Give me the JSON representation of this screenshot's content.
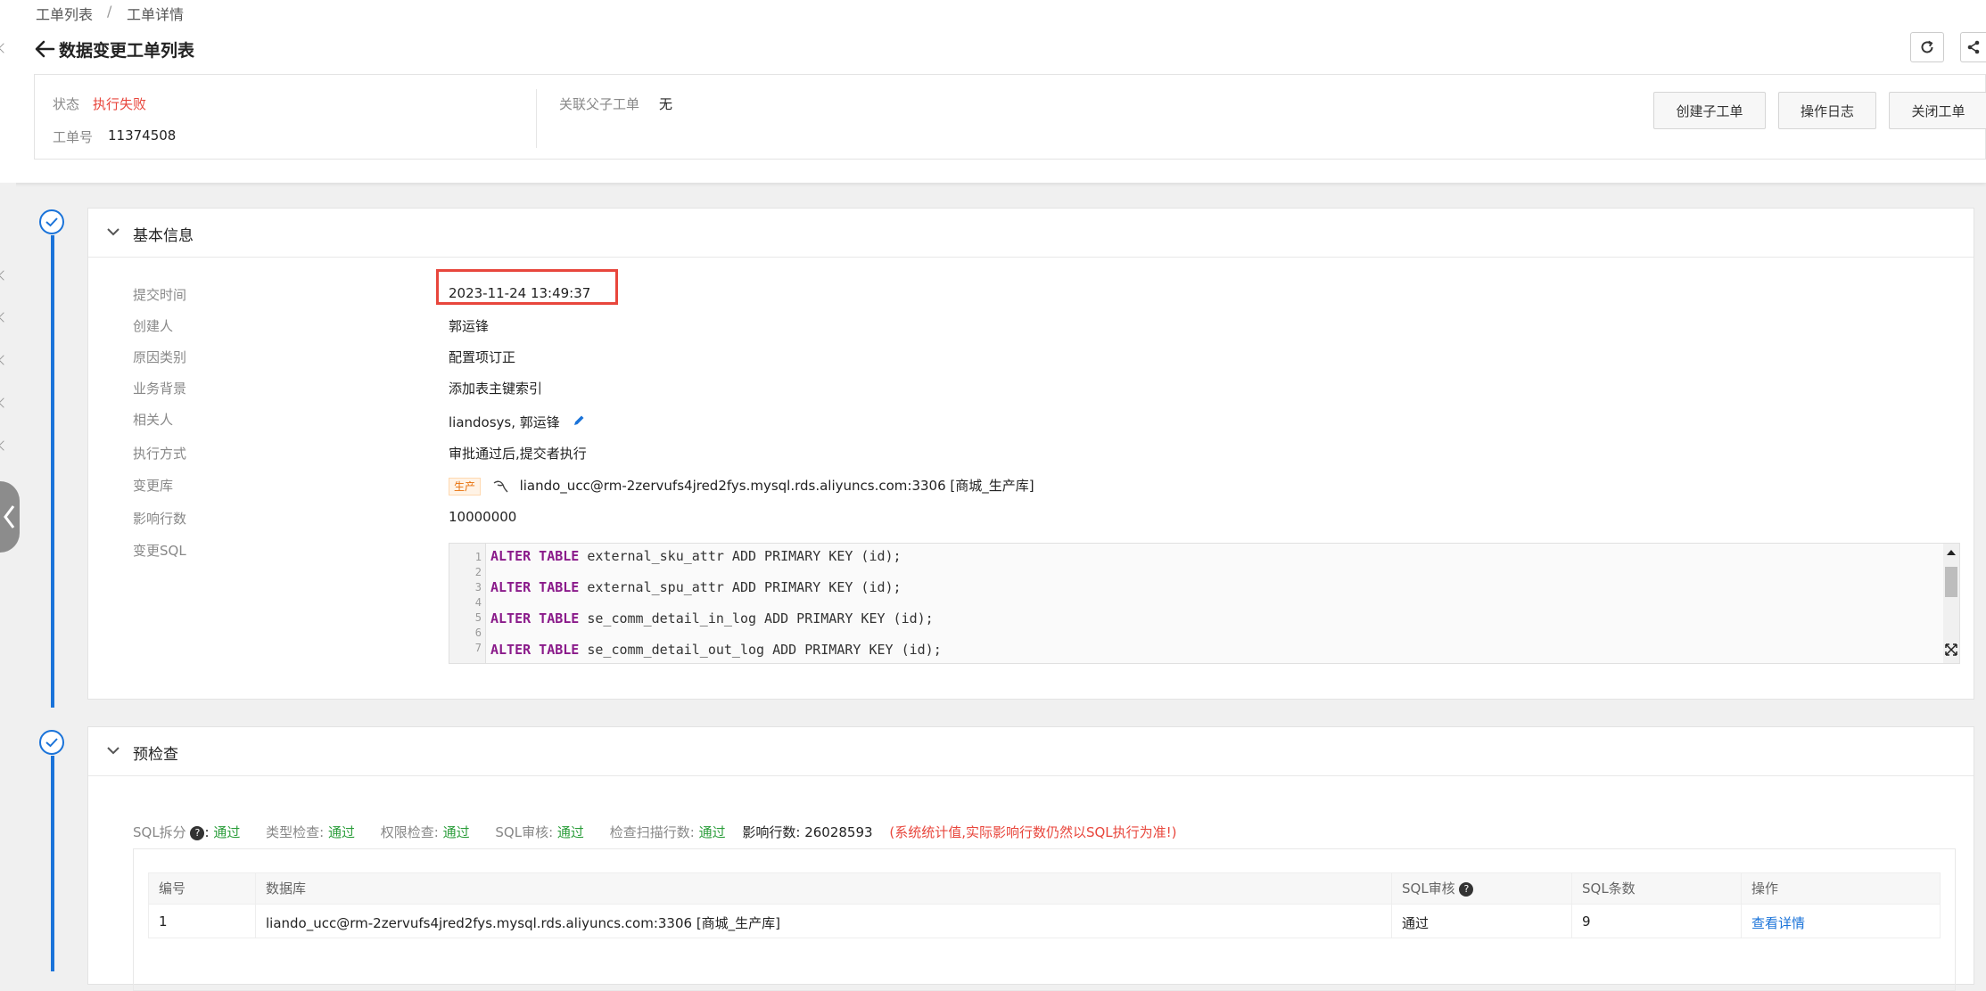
{
  "breadcrumb": {
    "item1": "工单列表",
    "sep": "/",
    "item2": "工单详情"
  },
  "page_title": "数据变更工单列表",
  "summary": {
    "status_label": "状态",
    "status_value": "执行失败",
    "ticket_label": "工单号",
    "ticket_value": "11374508",
    "related_label": "关联父子工单",
    "related_value": "无",
    "buttons": {
      "create_child": "创建子工单",
      "op_log": "操作日志",
      "close": "关闭工单"
    }
  },
  "basic_info": {
    "title": "基本信息",
    "submit_time_label": "提交时间",
    "submit_time": "2023-11-24 13:49:37",
    "creator_label": "创建人",
    "creator": "郭运锋",
    "reason_label": "原因类别",
    "reason": "配置项订正",
    "background_label": "业务背景",
    "background": "添加表主键索引",
    "related_people_label": "相关人",
    "related_people": "liandosys, 郭运锋",
    "exec_mode_label": "执行方式",
    "exec_mode": "审批通过后,提交者执行",
    "db_label": "变更库",
    "db_tag": "生产",
    "db_value": "liando_ucc@rm-2zervufs4jred2fys.mysql.rds.aliyuncs.com:3306 [商城_生产库]",
    "rows_label": "影响行数",
    "rows": "10000000",
    "sql_label": "变更SQL",
    "sql_lines": [
      {
        "num": "1",
        "kw": "ALTER TABLE",
        "rest": " external_sku_attr ADD PRIMARY KEY (id);"
      },
      {
        "num": "2",
        "kw": "",
        "rest": ""
      },
      {
        "num": "3",
        "kw": "ALTER TABLE",
        "rest": " external_spu_attr ADD PRIMARY KEY (id);"
      },
      {
        "num": "4",
        "kw": "",
        "rest": ""
      },
      {
        "num": "5",
        "kw": "ALTER TABLE",
        "rest": " se_comm_detail_in_log ADD PRIMARY KEY (id);"
      },
      {
        "num": "6",
        "kw": "",
        "rest": ""
      },
      {
        "num": "7",
        "kw": "ALTER TABLE",
        "rest": " se_comm_detail_out_log ADD PRIMARY KEY (id);"
      }
    ]
  },
  "precheck": {
    "title": "预检查",
    "sql_split_label": "SQL拆分",
    "sql_split_value": "通过",
    "type_check_label": "类型检查:",
    "type_check_value": "通过",
    "perm_check_label": "权限检查:",
    "perm_check_value": "通过",
    "sql_review_label": "SQL审核:",
    "sql_review_value": "通过",
    "scan_rows_label": "检查扫描行数:",
    "scan_rows_value": "通过",
    "affect_rows_label": "影响行数:",
    "affect_rows_value": "26028593",
    "note": "(系统统计值,实际影响行数仍然以SQL执行为准!)",
    "table": {
      "headers": {
        "num": "编号",
        "db": "数据库",
        "review": "SQL审核",
        "count": "SQL条数",
        "op": "操作"
      },
      "rows": [
        {
          "num": "1",
          "db": "liando_ucc@rm-2zervufs4jred2fys.mysql.rds.aliyuncs.com:3306 [商城_生产库]",
          "review": "通过",
          "count": "9",
          "op": "查看详情"
        }
      ]
    }
  }
}
